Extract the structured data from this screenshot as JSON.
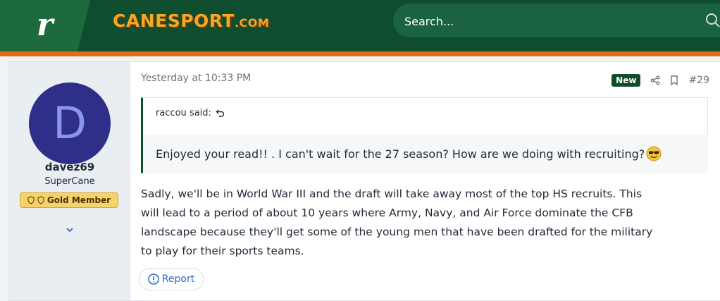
{
  "header": {
    "logo_letter": "r",
    "site_name": "CANESPORT",
    "site_tld": ".COM",
    "search_placeholder": "Search..."
  },
  "author": {
    "avatar_letter": "D",
    "username": "davez69",
    "title": "SuperCane",
    "badge": "Gold Member"
  },
  "post": {
    "timestamp": "Yesterday at 10:33 PM",
    "new_label": "New",
    "post_number": "#29",
    "quote_author": "raccou said:",
    "quote_text": "Enjoyed your read!! . I can't wait for the 27 season? How are we doing with recruiting?",
    "message_lines": [
      "Sadly, we'll be in World War III and the draft will take away most of the top HS recruits. This",
      "will lead to a period of about 10 years where Army, Navy, and Air Force dominate the CFB",
      "landscape because they'll get some of the young men that have been drafted for the military",
      "to play for their sports teams."
    ],
    "report_label": "Report"
  },
  "colors": {
    "header_green": "#0f4d2f",
    "stripe_orange": "#e46b16",
    "logo_gold": "#f5a623",
    "avatar_bg": "#2f2f8a",
    "badge_gold": "#f6d26a"
  },
  "icons": {
    "search": "search-icon",
    "share": "share-icon",
    "bookmark": "bookmark-icon",
    "expand": "chevron-down-icon",
    "quote_jump": "return-arrow-icon",
    "report": "exclamation-circle-icon",
    "emoji": "sunglasses-emoji-icon"
  }
}
